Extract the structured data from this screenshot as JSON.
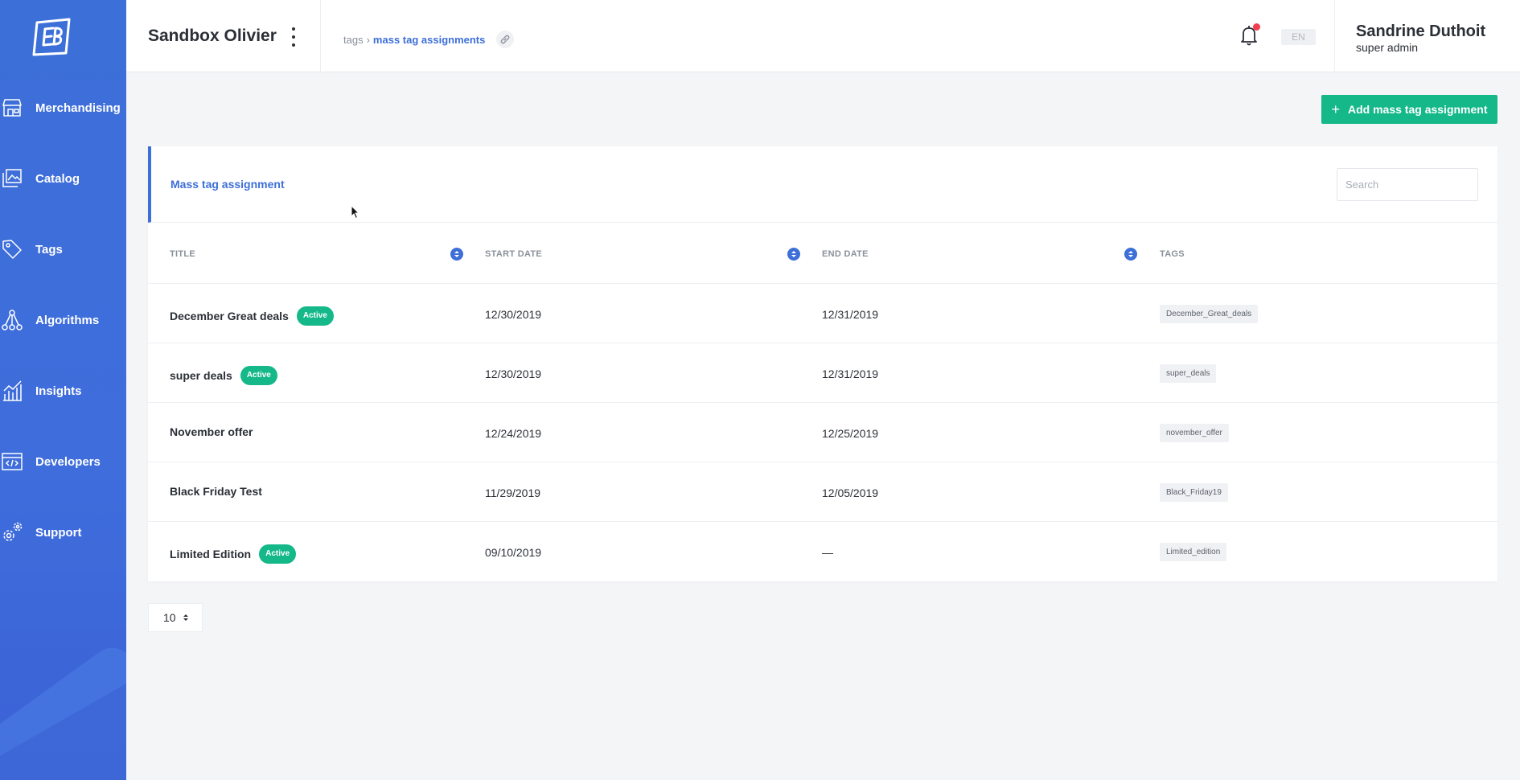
{
  "sidebar": {
    "items": [
      {
        "label": "Merchandising",
        "icon": "store-icon"
      },
      {
        "label": "Catalog",
        "icon": "images-icon"
      },
      {
        "label": "Tags",
        "icon": "tag-icon"
      },
      {
        "label": "Algorithms",
        "icon": "network-icon"
      },
      {
        "label": "Insights",
        "icon": "chart-icon"
      },
      {
        "label": "Developers",
        "icon": "code-icon"
      },
      {
        "label": "Support",
        "icon": "gears-icon"
      }
    ]
  },
  "header": {
    "app_title": "Sandbox Olivier",
    "breadcrumb": {
      "parent": "tags",
      "separator": "›",
      "current": "mass tag assignments"
    },
    "language": "EN",
    "user": {
      "name": "Sandrine Duthoit",
      "role": "super admin"
    }
  },
  "toolbar": {
    "add_label": "Add mass tag assignment"
  },
  "card": {
    "title": "Mass tag assignment",
    "search": {
      "placeholder": "Search",
      "value": ""
    }
  },
  "table": {
    "columns": [
      "TITLE",
      "START DATE",
      "END DATE",
      "TAGS"
    ],
    "rows": [
      {
        "title": "December Great deals",
        "badge": "Active",
        "start": "12/30/2019",
        "end": "12/31/2019",
        "tag": "December_Great_deals"
      },
      {
        "title": "super deals",
        "badge": "Active",
        "start": "12/30/2019",
        "end": "12/31/2019",
        "tag": "super_deals"
      },
      {
        "title": "November offer",
        "badge": "",
        "start": "12/24/2019",
        "end": "12/25/2019",
        "tag": "november_offer"
      },
      {
        "title": "Black Friday Test",
        "badge": "",
        "start": "11/29/2019",
        "end": "12/05/2019",
        "tag": "Black_Friday19"
      },
      {
        "title": "Limited Edition",
        "badge": "Active",
        "start": "09/10/2019",
        "end": "—",
        "tag": "Limited_edition"
      }
    ]
  },
  "pagination": {
    "page_size": "10"
  },
  "colors": {
    "primary": "#3d6fd8",
    "success": "#14b889",
    "notification": "#f23d4f"
  }
}
